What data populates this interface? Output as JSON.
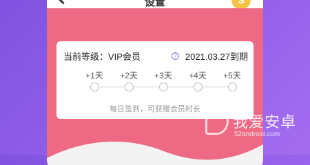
{
  "header": {
    "title": "设置",
    "coin_glyph": "S"
  },
  "card": {
    "level_label": "当前等级：VIP会员",
    "expire_text": "2021.03.27到期",
    "help_glyph": "?",
    "days": [
      "+1天",
      "+2天",
      "+3天",
      "+4天",
      "+5天"
    ],
    "hint": "每日签到，可获赠会员时长"
  },
  "watermark": {
    "text": "我爱安卓",
    "url": "52android.com"
  },
  "colors": {
    "background_start": "#7f53e0",
    "background_end": "#a56df0",
    "pink_panel": "#ee6a84",
    "coin": "#f7c248"
  }
}
